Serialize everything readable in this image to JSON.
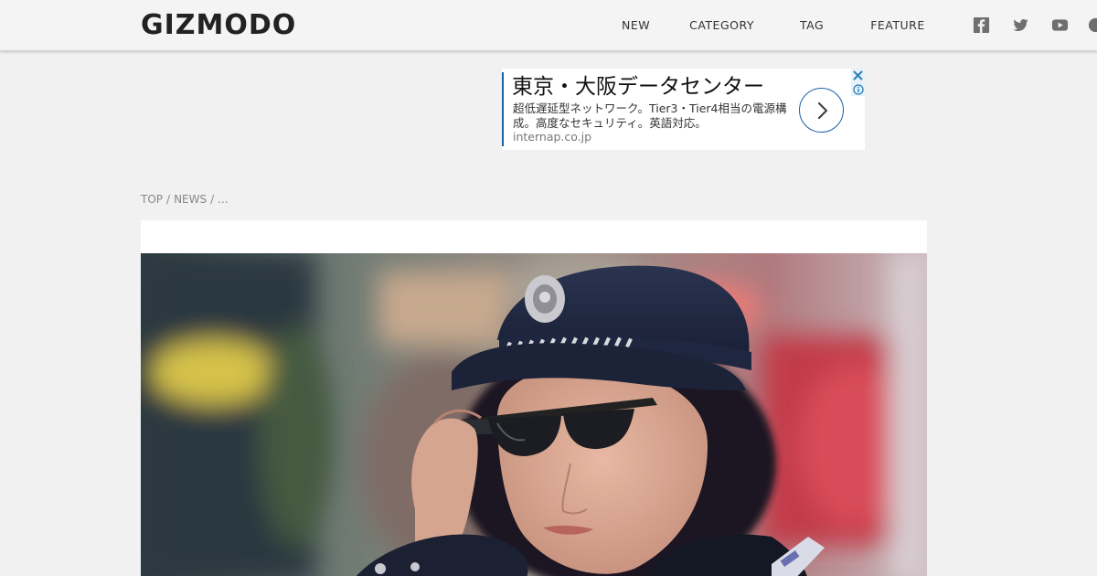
{
  "header": {
    "logo": "GIZMODO",
    "nav": [
      {
        "label": "NEW"
      },
      {
        "label": "CATEGORY"
      },
      {
        "label": "TAG"
      },
      {
        "label": "FEATURE"
      }
    ],
    "social": [
      "facebook-icon",
      "twitter-icon",
      "youtube-icon",
      "more-icon"
    ]
  },
  "ad": {
    "title": "東京・大阪データセンター",
    "description": "超低遅延型ネットワーク。Tier3・Tier4相当の電源構成。高度なセキュリティ。英語対応。",
    "url": "internap.co.jp",
    "accent": "#1a5fa8"
  },
  "breadcrumb": {
    "items": [
      "TOP",
      "NEWS",
      "..."
    ],
    "separator": "/"
  },
  "article": {
    "hero_image": "police-officer-wearing-smart-glasses"
  },
  "colors": {
    "page_bg": "#f1f1f1",
    "header_bg": "#f4f4f4",
    "ad_accent": "#1a5fa8"
  }
}
